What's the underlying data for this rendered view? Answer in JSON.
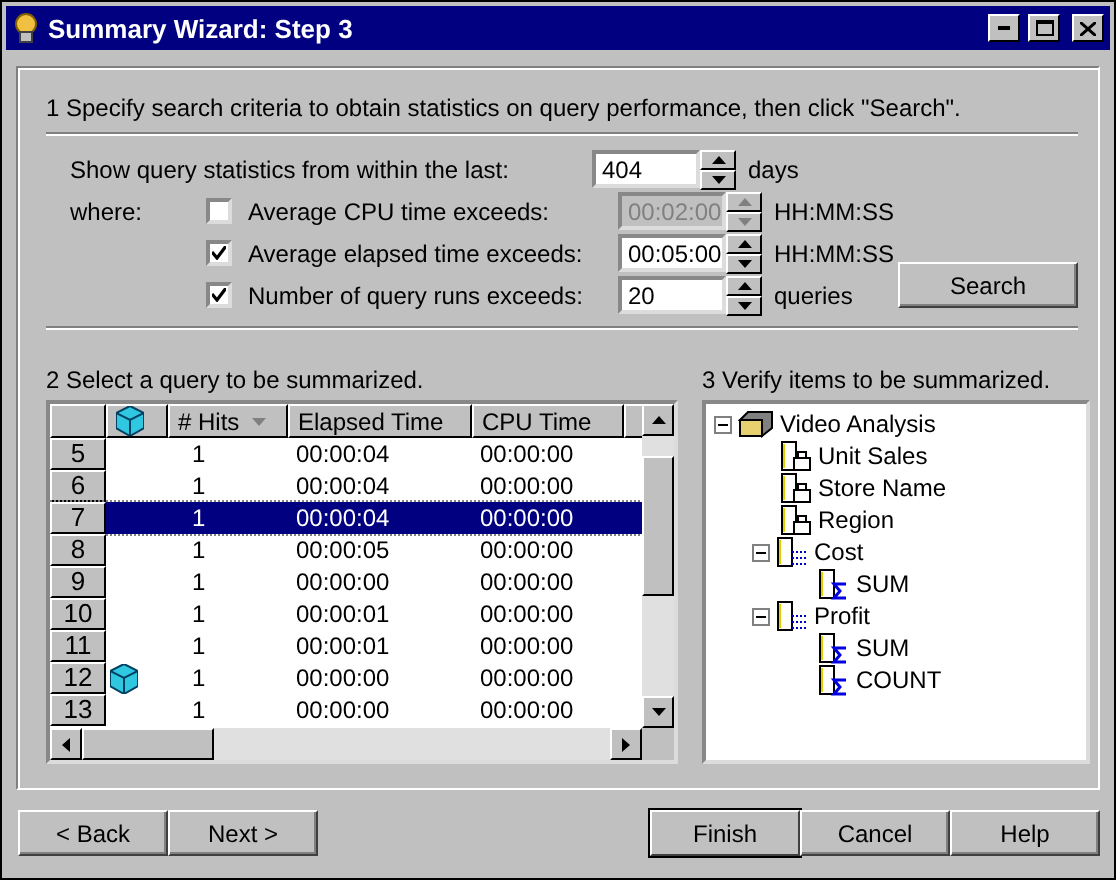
{
  "window": {
    "title": "Summary Wizard: Step 3"
  },
  "step1": {
    "heading": "1  Specify search criteria to obtain statistics on query performance, then click \"Search\".",
    "period": {
      "label": "Show query statistics from within the last:",
      "value": "404",
      "unit": "days"
    },
    "where_label": "where:",
    "criteria": [
      {
        "label": "Average CPU time exceeds:",
        "checked": false,
        "value": "00:02:00",
        "unit": "HH:MM:SS"
      },
      {
        "label": "Average elapsed time exceeds:",
        "checked": true,
        "value": "00:05:00",
        "unit": "HH:MM:SS"
      },
      {
        "label": "Number of query runs exceeds:",
        "checked": true,
        "value": "20",
        "unit": "queries"
      }
    ],
    "search_button": "Search"
  },
  "step2": {
    "heading": "2  Select a query to be summarized.",
    "columns": [
      "# Hits",
      "Elapsed Time",
      "CPU Time"
    ],
    "rows": [
      {
        "number": "5",
        "cached": false,
        "hits": "1",
        "elapsed": "00:00:04",
        "cpu": "00:00:00",
        "selected": false
      },
      {
        "number": "6",
        "cached": false,
        "hits": "1",
        "elapsed": "00:00:04",
        "cpu": "00:00:00",
        "selected": false
      },
      {
        "number": "7",
        "cached": false,
        "hits": "1",
        "elapsed": "00:00:04",
        "cpu": "00:00:00",
        "selected": true
      },
      {
        "number": "8",
        "cached": false,
        "hits": "1",
        "elapsed": "00:00:05",
        "cpu": "00:00:00",
        "selected": false
      },
      {
        "number": "9",
        "cached": false,
        "hits": "1",
        "elapsed": "00:00:00",
        "cpu": "00:00:00",
        "selected": false
      },
      {
        "number": "10",
        "cached": false,
        "hits": "1",
        "elapsed": "00:00:01",
        "cpu": "00:00:00",
        "selected": false
      },
      {
        "number": "11",
        "cached": false,
        "hits": "1",
        "elapsed": "00:00:01",
        "cpu": "00:00:00",
        "selected": false
      },
      {
        "number": "12",
        "cached": true,
        "hits": "1",
        "elapsed": "00:00:00",
        "cpu": "00:00:00",
        "selected": false
      },
      {
        "number": "13",
        "cached": false,
        "hits": "1",
        "elapsed": "00:00:00",
        "cpu": "00:00:00",
        "selected": false
      }
    ]
  },
  "step3": {
    "heading": "3  Verify items to be summarized.",
    "tree": [
      {
        "label": "Video Analysis",
        "kind": "cube",
        "expanded": true,
        "children": [
          {
            "label": "Unit Sales",
            "kind": "dimension"
          },
          {
            "label": "Store Name",
            "kind": "dimension"
          },
          {
            "label": "Region",
            "kind": "dimension"
          },
          {
            "label": "Cost",
            "kind": "measure",
            "expanded": true,
            "children": [
              {
                "label": "SUM",
                "kind": "function"
              }
            ]
          },
          {
            "label": "Profit",
            "kind": "measure",
            "expanded": true,
            "children": [
              {
                "label": "SUM",
                "kind": "function"
              },
              {
                "label": "COUNT",
                "kind": "function"
              }
            ]
          }
        ]
      }
    ]
  },
  "nav_buttons": [
    {
      "label": "< Back",
      "default": false
    },
    {
      "label": "Next >",
      "default": false
    }
  ],
  "action_buttons": [
    {
      "label": "Finish",
      "default": true
    },
    {
      "label": "Cancel",
      "default": false
    },
    {
      "label": "Help",
      "default": false
    }
  ]
}
